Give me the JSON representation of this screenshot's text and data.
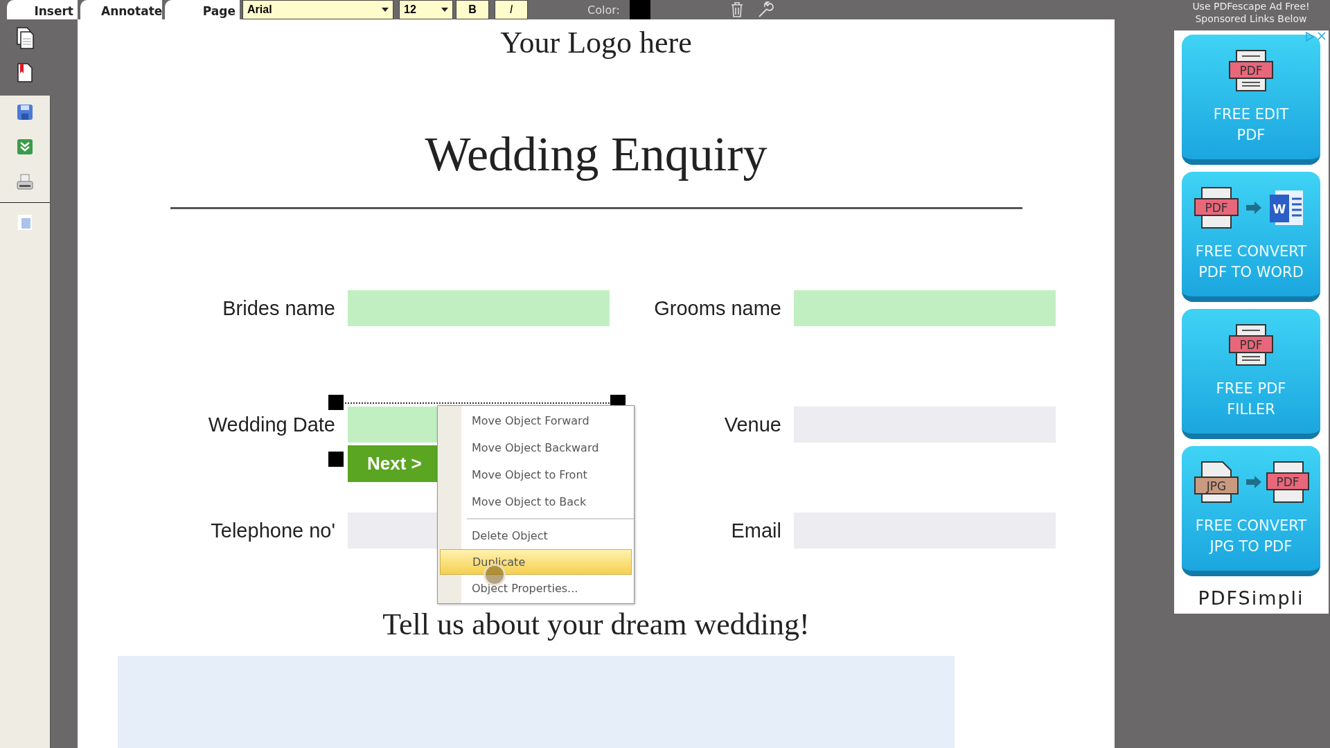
{
  "toolbar": {
    "tabs": [
      {
        "label": "Insert"
      },
      {
        "label": "Annotate"
      },
      {
        "label": "Page"
      }
    ],
    "font": "Arial",
    "size": "12",
    "bold": "B",
    "italic": "I",
    "color_label": "Color:",
    "color": "#000000"
  },
  "ad_notice": [
    "Use PDFescape Ad Free!",
    "Sponsored Links Below"
  ],
  "document": {
    "logo": "Your Logo here",
    "title": "Wedding Enquiry",
    "rows": [
      [
        {
          "label": "Brides name",
          "color": "#c2efc2"
        },
        {
          "label": "Grooms name",
          "color": "#c2efc2"
        }
      ],
      [
        {
          "label": "Wedding Date",
          "color": "#c2efc2",
          "button": "Next >"
        },
        {
          "label": "Venue",
          "color": "#ececf1"
        }
      ],
      [
        {
          "label": "Telephone no'",
          "color": "#ececf1"
        },
        {
          "label": "Email",
          "color": "#ececf1"
        }
      ]
    ],
    "prompt": "Tell us about your dream wedding!"
  },
  "context_menu": [
    {
      "kind": "item",
      "label": "Move Object Forward",
      "selected": false
    },
    {
      "kind": "item",
      "label": "Move Object Backward",
      "selected": false
    },
    {
      "kind": "item",
      "label": "Move Object to Front",
      "selected": false
    },
    {
      "kind": "item",
      "label": "Move Object to Back",
      "selected": false
    },
    {
      "kind": "separator"
    },
    {
      "kind": "item",
      "label": "Delete Object",
      "selected": false
    },
    {
      "kind": "item",
      "label": "Duplicate",
      "selected": true
    },
    {
      "kind": "item",
      "label": "Object Properties...",
      "selected": false
    }
  ],
  "ad": {
    "tiles": [
      {
        "kind": "edit",
        "icon_text": [
          "PDF"
        ],
        "lines": [
          "FREE EDIT",
          "PDF"
        ]
      },
      {
        "kind": "word",
        "icon_text": [
          "PDF",
          "W"
        ],
        "lines": [
          "FREE CONVERT",
          "PDF TO WORD"
        ]
      },
      {
        "kind": "filler",
        "icon_text": [
          "PDF"
        ],
        "lines": [
          "FREE PDF",
          "FILLER"
        ]
      },
      {
        "kind": "jpg",
        "icon_text": [
          "JPG",
          "PDF"
        ],
        "lines": [
          "FREE CONVERT",
          "JPG TO PDF"
        ]
      }
    ],
    "brand": "PDFSimpli"
  }
}
